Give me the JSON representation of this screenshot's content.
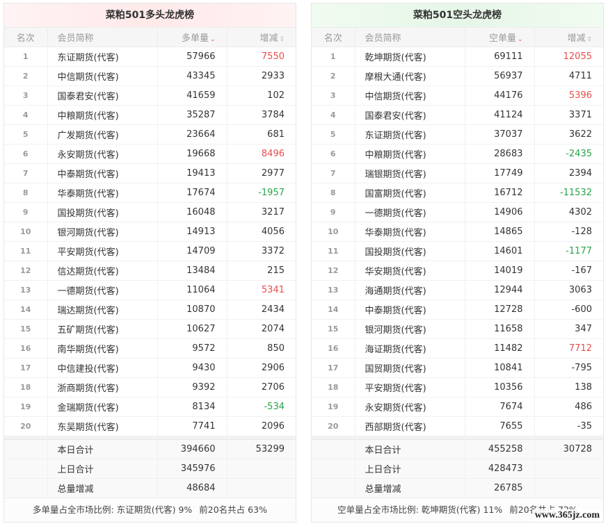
{
  "long": {
    "title": "菜粕501多头龙虎榜",
    "headers": {
      "rank": "名次",
      "name": "会员简称",
      "volume": "多单量",
      "change": "增减"
    },
    "rows": [
      {
        "rank": "1",
        "name": "东证期货(代客)",
        "volume": "57966",
        "change": "7550",
        "color": "red"
      },
      {
        "rank": "2",
        "name": "中信期货(代客)",
        "volume": "43345",
        "change": "2933",
        "color": ""
      },
      {
        "rank": "3",
        "name": "国泰君安(代客)",
        "volume": "41659",
        "change": "102",
        "color": ""
      },
      {
        "rank": "4",
        "name": "中粮期货(代客)",
        "volume": "35287",
        "change": "3784",
        "color": ""
      },
      {
        "rank": "5",
        "name": "广发期货(代客)",
        "volume": "23664",
        "change": "681",
        "color": ""
      },
      {
        "rank": "6",
        "name": "永安期货(代客)",
        "volume": "19668",
        "change": "8496",
        "color": "red"
      },
      {
        "rank": "7",
        "name": "中泰期货(代客)",
        "volume": "19413",
        "change": "2977",
        "color": ""
      },
      {
        "rank": "8",
        "name": "华泰期货(代客)",
        "volume": "17674",
        "change": "-1957",
        "color": "green"
      },
      {
        "rank": "9",
        "name": "国投期货(代客)",
        "volume": "16048",
        "change": "3217",
        "color": ""
      },
      {
        "rank": "10",
        "name": "银河期货(代客)",
        "volume": "14913",
        "change": "4056",
        "color": ""
      },
      {
        "rank": "11",
        "name": "平安期货(代客)",
        "volume": "14709",
        "change": "3372",
        "color": ""
      },
      {
        "rank": "12",
        "name": "信达期货(代客)",
        "volume": "13484",
        "change": "215",
        "color": ""
      },
      {
        "rank": "13",
        "name": "一德期货(代客)",
        "volume": "11064",
        "change": "5341",
        "color": "red"
      },
      {
        "rank": "14",
        "name": "瑞达期货(代客)",
        "volume": "10870",
        "change": "2434",
        "color": ""
      },
      {
        "rank": "15",
        "name": "五矿期货(代客)",
        "volume": "10627",
        "change": "2074",
        "color": ""
      },
      {
        "rank": "16",
        "name": "南华期货(代客)",
        "volume": "9572",
        "change": "850",
        "color": ""
      },
      {
        "rank": "17",
        "name": "中信建投(代客)",
        "volume": "9430",
        "change": "2906",
        "color": ""
      },
      {
        "rank": "18",
        "name": "浙商期货(代客)",
        "volume": "9392",
        "change": "2706",
        "color": ""
      },
      {
        "rank": "19",
        "name": "金瑞期货(代客)",
        "volume": "8134",
        "change": "-534",
        "color": "green"
      },
      {
        "rank": "20",
        "name": "东吴期货(代客)",
        "volume": "7741",
        "change": "2096",
        "color": ""
      }
    ],
    "summary": [
      {
        "label": "本日合计",
        "volume": "394660",
        "change": "53299"
      },
      {
        "label": "上日合计",
        "volume": "345976",
        "change": ""
      },
      {
        "label": "总量增减",
        "volume": "48684",
        "change": ""
      }
    ],
    "footer": {
      "ratio_text": "多单量占全市场比例: 东证期货(代客) 9%",
      "top20_text": "前20名共占 63%"
    }
  },
  "short": {
    "title": "菜粕501空头龙虎榜",
    "headers": {
      "rank": "名次",
      "name": "会员简称",
      "volume": "空单量",
      "change": "增减"
    },
    "rows": [
      {
        "rank": "1",
        "name": "乾坤期货(代客)",
        "volume": "69111",
        "change": "12055",
        "color": "red"
      },
      {
        "rank": "2",
        "name": "摩根大通(代客)",
        "volume": "56937",
        "change": "4711",
        "color": ""
      },
      {
        "rank": "3",
        "name": "中信期货(代客)",
        "volume": "44176",
        "change": "5396",
        "color": "red"
      },
      {
        "rank": "4",
        "name": "国泰君安(代客)",
        "volume": "41124",
        "change": "3371",
        "color": ""
      },
      {
        "rank": "5",
        "name": "东证期货(代客)",
        "volume": "37037",
        "change": "3622",
        "color": ""
      },
      {
        "rank": "6",
        "name": "中粮期货(代客)",
        "volume": "28683",
        "change": "-2435",
        "color": "green"
      },
      {
        "rank": "7",
        "name": "瑞银期货(代客)",
        "volume": "17749",
        "change": "2394",
        "color": ""
      },
      {
        "rank": "8",
        "name": "国富期货(代客)",
        "volume": "16712",
        "change": "-11532",
        "color": "green"
      },
      {
        "rank": "9",
        "name": "一德期货(代客)",
        "volume": "14906",
        "change": "4302",
        "color": ""
      },
      {
        "rank": "10",
        "name": "华泰期货(代客)",
        "volume": "14865",
        "change": "-128",
        "color": ""
      },
      {
        "rank": "11",
        "name": "国投期货(代客)",
        "volume": "14601",
        "change": "-1177",
        "color": "green"
      },
      {
        "rank": "12",
        "name": "华安期货(代客)",
        "volume": "14019",
        "change": "-167",
        "color": ""
      },
      {
        "rank": "13",
        "name": "海通期货(代客)",
        "volume": "12944",
        "change": "3063",
        "color": ""
      },
      {
        "rank": "14",
        "name": "中泰期货(代客)",
        "volume": "12728",
        "change": "-600",
        "color": ""
      },
      {
        "rank": "15",
        "name": "银河期货(代客)",
        "volume": "11658",
        "change": "347",
        "color": ""
      },
      {
        "rank": "16",
        "name": "海证期货(代客)",
        "volume": "11482",
        "change": "7712",
        "color": "red"
      },
      {
        "rank": "17",
        "name": "国贸期货(代客)",
        "volume": "10841",
        "change": "-795",
        "color": ""
      },
      {
        "rank": "18",
        "name": "平安期货(代客)",
        "volume": "10356",
        "change": "138",
        "color": ""
      },
      {
        "rank": "19",
        "name": "永安期货(代客)",
        "volume": "7674",
        "change": "486",
        "color": ""
      },
      {
        "rank": "20",
        "name": "西部期货(代客)",
        "volume": "7655",
        "change": "-35",
        "color": ""
      }
    ],
    "summary": [
      {
        "label": "本日合计",
        "volume": "455258",
        "change": "30728"
      },
      {
        "label": "上日合计",
        "volume": "428473",
        "change": ""
      },
      {
        "label": "总量增减",
        "volume": "26785",
        "change": ""
      }
    ],
    "footer": {
      "ratio_text": "空单量占全市场比例: 乾坤期货(代客) 11%",
      "top20_text": "前20名共占 72%"
    }
  },
  "colors": {
    "up": "#e84c4c",
    "down": "#2aa24a"
  },
  "watermark": "www.365jz.com"
}
